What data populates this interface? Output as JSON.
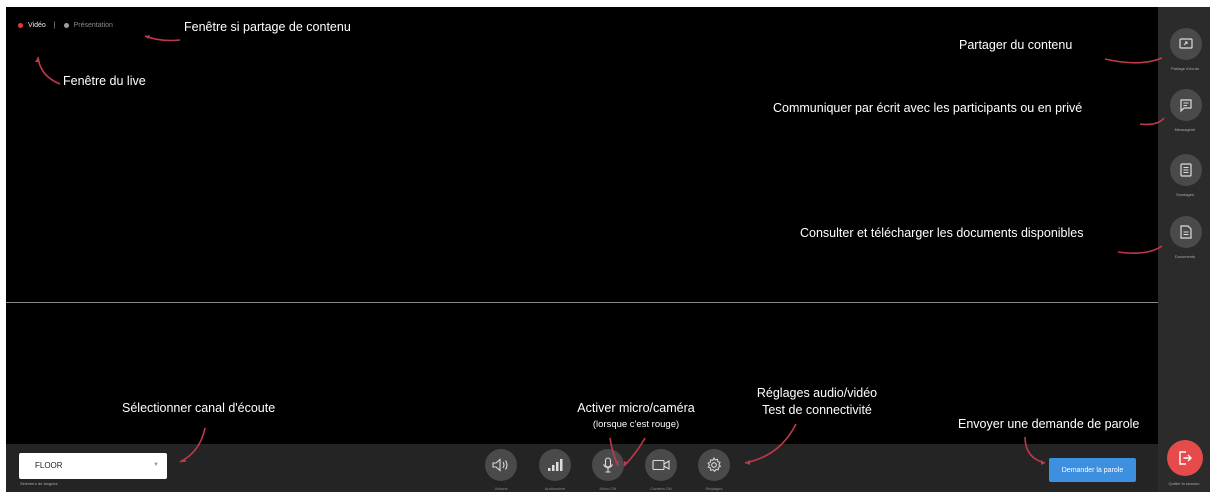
{
  "tabs": {
    "video": "Vidéo",
    "separator": "|",
    "presentation": "Présentation",
    "active_dot_color": "#e53935",
    "inactive_dot_color": "#9e9e9e"
  },
  "sidebar": {
    "items": [
      {
        "label": "Partage d'écran",
        "icon": "screen-share-icon"
      },
      {
        "label": "Messagerie",
        "icon": "message-icon"
      },
      {
        "label": "Sondages",
        "icon": "poll-icon"
      },
      {
        "label": "Documents",
        "icon": "document-icon"
      }
    ]
  },
  "language": {
    "value": "FLOOR",
    "caption": "Sélecteur de langues"
  },
  "controls": [
    {
      "label": "Volume",
      "icon": "speaker-icon"
    },
    {
      "label": "Audiomètre",
      "icon": "level-meter-icon"
    },
    {
      "label": "Micro ON",
      "icon": "microphone-icon"
    },
    {
      "label": "Caméra ON",
      "icon": "camera-icon"
    },
    {
      "label": "Réglages",
      "icon": "gear-icon"
    }
  ],
  "ask_button": "Demander la parole",
  "quit": {
    "label": "Quitter la session",
    "icon": "exit-icon",
    "color": "#e54b4b"
  },
  "accent_color": "#3d8fe0",
  "annotations": {
    "window_share": "Fenêtre si partage de contenu",
    "live_window": "Fenêtre du live",
    "share_content": "Partager du contenu",
    "communicate": "Communiquer par écrit avec les participants ou en privé",
    "documents": "Consulter et télécharger les documents disponibles",
    "select_channel": "Sélectionner canal d'écoute",
    "activate_mic": "Activer micro/caméra",
    "activate_mic_sub": "(lorsque c'est rouge)",
    "av_settings_1": "Réglages audio/vidéo",
    "av_settings_2": "Test de connectivité",
    "request_speech": "Envoyer une demande de parole"
  },
  "annotation_arrow_color": "#c0394b"
}
